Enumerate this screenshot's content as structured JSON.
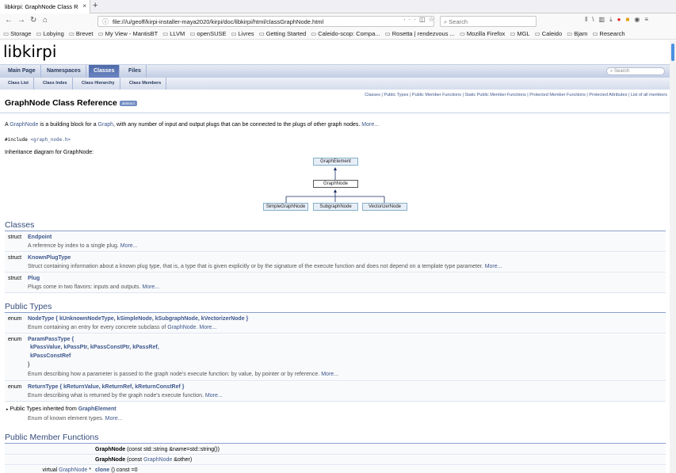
{
  "browser": {
    "tab_title": "libkirpi: GraphNode Class R",
    "tab_close": "×",
    "new_tab": "+",
    "url": "file:///u/geoff/kirpi-installer-maya2020/kirpi/doc/libkirpi/html/classGraphNode.html",
    "url_menu": "···",
    "search_placeholder": "Search",
    "bookmarks": [
      "Storage",
      "Lobying",
      "Brevet",
      "My View - MantisBT",
      "LLVM",
      "openSUSE",
      "Livres",
      "Getting Started",
      "Caleido-scop: Compa...",
      "Rosetta | rendezvous ...",
      "Mozilla Firefox",
      "MGL",
      "Caleido",
      "Bjam",
      "Research"
    ]
  },
  "doc": {
    "project_name": "libkirpi",
    "main_tabs": [
      "Main Page",
      "Namespaces",
      "Classes",
      "Files"
    ],
    "active_tab": "Classes",
    "search_placeholder": "Search",
    "sub_tabs": [
      "Class List",
      "Class Index",
      "Class Hierarchy",
      "Class Members"
    ],
    "summary_links": "Classes | Public Types | Public Member Functions | Static Public Member Functions | Protected Member Functions | Protected Attributes | List of all members",
    "title": "GraphNode Class Reference",
    "badge": "abstract",
    "brief": {
      "a": "A ",
      "graphnode": "GraphNode",
      "mid": " is a building block for a ",
      "graph": "Graph",
      "rest": ", with any number of input and output plugs that can be connected to the plugs of other graph nodes. ",
      "more": "More..."
    },
    "include_prefix": "#include ",
    "include_file": "<graph_node.h>",
    "inheritance_label": "Inheritance diagram for GraphNode:",
    "diagram": {
      "parent": "GraphElement",
      "current": "GraphNode",
      "children": [
        "SimpleGraphNode",
        "SubgraphNode",
        "VectorizerNode"
      ]
    },
    "sections": {
      "classes": "Classes",
      "public_types": "Public Types",
      "public_member_functions": "Public Member Functions"
    },
    "classes": [
      {
        "kind": "struct",
        "name": "Endpoint",
        "desc": "A reference by index to a single plug. ",
        "more": "More..."
      },
      {
        "kind": "struct",
        "name": "KnownPlugType",
        "desc": "Struct containing information about a known plug type, that is, a type that is given explicitly or by the signature of the execute function and does not depend on a template type parameter. ",
        "more": "More..."
      },
      {
        "kind": "struct",
        "name": "Plug",
        "desc": "Plugs come in two flavors: inputs and outputs. ",
        "more": "More..."
      }
    ],
    "types": {
      "nodetype": {
        "kind": "enum",
        "name": "NodeType",
        "values": "{ kUnknownNodeType, kSimpleNode, kSubgraphNode, kVectorizerNode }",
        "desc_a": "Enum containing an entry for every concrete subclass of ",
        "desc_link": "GraphNode",
        "desc_b": ". ",
        "more": "More..."
      },
      "parampass": {
        "kind": "enum",
        "name": "ParamPassType",
        "open": "{",
        "line1": "kPassValue, kPassPtr, kPassConstPtr, kPassRef,",
        "line2": "kPassConstRef",
        "close": "}",
        "desc": "Enum describing how a parameter is passed to the graph node's execute function: by value, by pointer or by reference. ",
        "more": "More..."
      },
      "returntype": {
        "kind": "enum",
        "name": "ReturnType",
        "values": "{ kReturnValue, kReturnRef, kReturnConstRef }",
        "desc": "Enum describing what is returned by the graph node's execute function. ",
        "more": "More..."
      },
      "inherited": {
        "prefix": "Public Types inherited from ",
        "link": "GraphElement",
        "desc": "Enum of known element types. ",
        "more": "More..."
      }
    },
    "functions": [
      {
        "ret": "",
        "name": "GraphNode",
        "args": " (const std::string &name=std::string())"
      },
      {
        "ret": "",
        "name": "GraphNode",
        "args_a": " (const ",
        "args_link": "GraphNode",
        "args_b": " &other)"
      },
      {
        "ret_a": "virtual ",
        "ret_link": "GraphNode",
        "ret_b": " *",
        "name": "clone",
        "args": " () const =0"
      }
    ]
  }
}
